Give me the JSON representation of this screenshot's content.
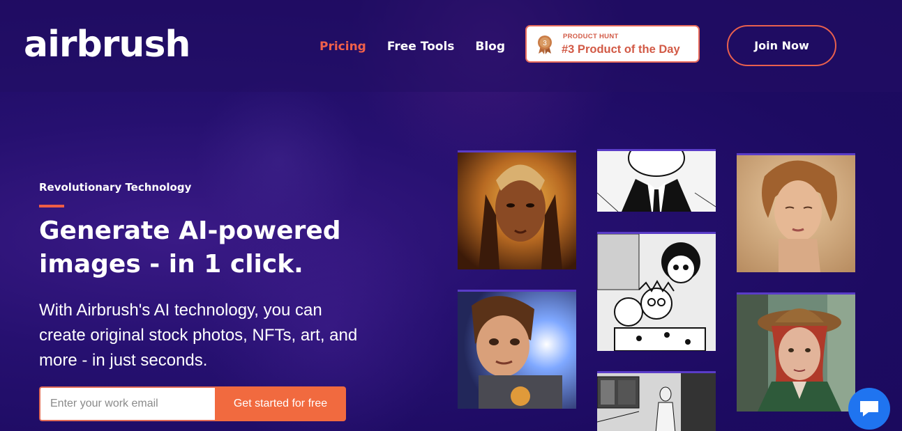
{
  "header": {
    "logo": "airbrush",
    "nav": [
      {
        "label": "Pricing",
        "active": true
      },
      {
        "label": "Free Tools",
        "active": false
      },
      {
        "label": "Blog",
        "active": false
      }
    ],
    "product_hunt": {
      "top_label": "PRODUCT HUNT",
      "main_label": "#3 Product of the Day",
      "medal_number": "3"
    },
    "join_label": "Join Now"
  },
  "hero": {
    "eyebrow": "Revolutionary Technology",
    "headline": "Generate AI-powered images - in 1 click.",
    "subtext": "With Airbrush's AI technology, you can create original stock photos, NFTs, art, and more - in just seconds.",
    "email_placeholder": "Enter your work email",
    "cta_label": "Get started for free"
  },
  "gallery": [
    {
      "name": "warrior-woman-image"
    },
    {
      "name": "comic-man-suit-image"
    },
    {
      "name": "woman-portrait-image"
    },
    {
      "name": "cartoon-girl-image"
    },
    {
      "name": "comic-family-image"
    },
    {
      "name": "woman-hat-image"
    },
    {
      "name": "comic-kitchen-image"
    }
  ],
  "colors": {
    "accent": "#f1604a",
    "cta": "#f16a3f",
    "background": "#1d0b62",
    "chat": "#1f74f0"
  },
  "icons": {
    "medal": "medal-icon",
    "chat": "chat-icon"
  }
}
